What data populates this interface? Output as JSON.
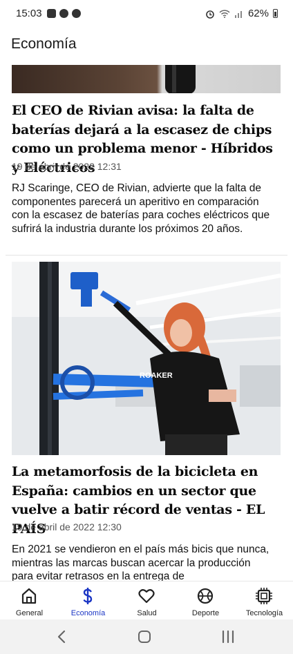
{
  "status": {
    "time": "15:03",
    "battery": "62%",
    "left_icons": [
      "gallery-icon",
      "alert-icon",
      "a-icon"
    ],
    "right_icons": [
      "alarm-icon",
      "wifi-icon",
      "signal-icon",
      "battery-icon"
    ]
  },
  "header": {
    "title": "Economía"
  },
  "articles": [
    {
      "title": "El CEO de Rivian avisa: la falta de baterías dejará a la escasez de chips como un problema menor - Híbridos y Eléctricos",
      "date": "19 de abril de 2022 12:31",
      "summary": "RJ Scaringe, CEO de Rivian, advierte que la falta de componentes parecerá un aperitivo en comparación con la escasez de baterías para coches eléctricos que sufrirá la industria durante los próximos 20 años."
    },
    {
      "title": "La metamorfosis de la bicicleta en España: cambios en un sector que vuelve a batir récord de ventas - EL PAÍS",
      "date": "19 de abril de 2022 12:30",
      "summary": "En 2021 se vendieron en el país más bicis que nunca, mientras las marcas buscan acercar la producción para evitar retrasos en la entrega de",
      "image_text": "ROAKER"
    }
  ],
  "nav": {
    "items": [
      {
        "label": "General",
        "icon": "home-icon",
        "active": false
      },
      {
        "label": "Economía",
        "icon": "dollar-icon",
        "active": true
      },
      {
        "label": "Salud",
        "icon": "heart-icon",
        "active": false
      },
      {
        "label": "Deporte",
        "icon": "basketball-icon",
        "active": false
      },
      {
        "label": "Tecnología",
        "icon": "chip-icon",
        "active": false
      }
    ]
  },
  "colors": {
    "active": "#1a35c4",
    "text": "#0a0a0a",
    "muted": "#555555"
  }
}
